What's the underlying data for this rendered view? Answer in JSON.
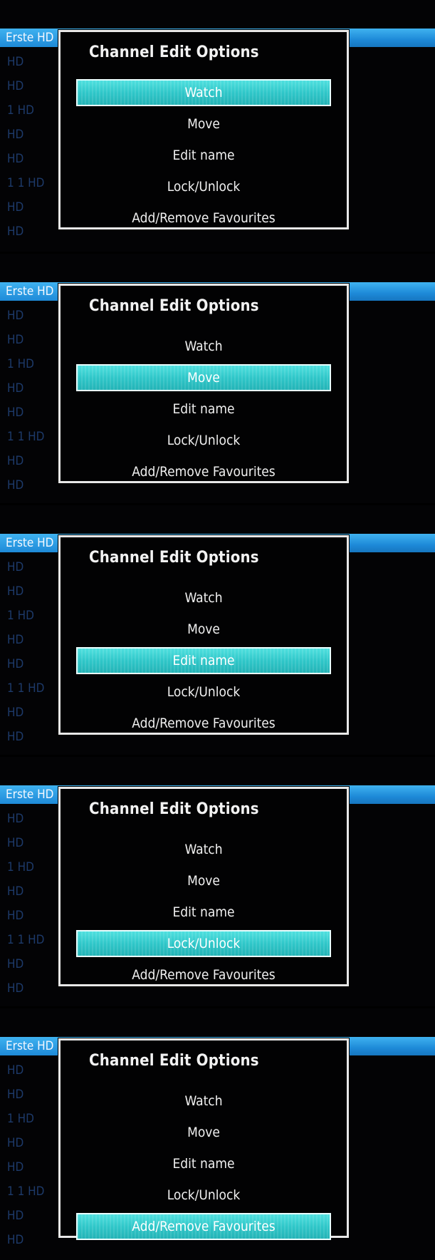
{
  "channel_header": "Erste HD",
  "channel_list": [
    "HD",
    "HD",
    "1 HD",
    "HD",
    "HD",
    "1 1 HD",
    "HD",
    "HD"
  ],
  "dialog": {
    "title": "Channel Edit Options",
    "options": [
      "Watch",
      "Move",
      "Edit name",
      "Lock/Unlock",
      "Add/Remove Favourites"
    ]
  },
  "frames": [
    {
      "selected_option": "Watch"
    },
    {
      "selected_option": "Move"
    },
    {
      "selected_option": "Edit name"
    },
    {
      "selected_option": "Lock/Unlock"
    },
    {
      "selected_option": "Add/Remove Favourites"
    }
  ],
  "colors": {
    "highlight": "#34c9cb",
    "header_bar": "#1e8ad8",
    "dialog_border": "#e8e8e8",
    "background": "#030305"
  }
}
